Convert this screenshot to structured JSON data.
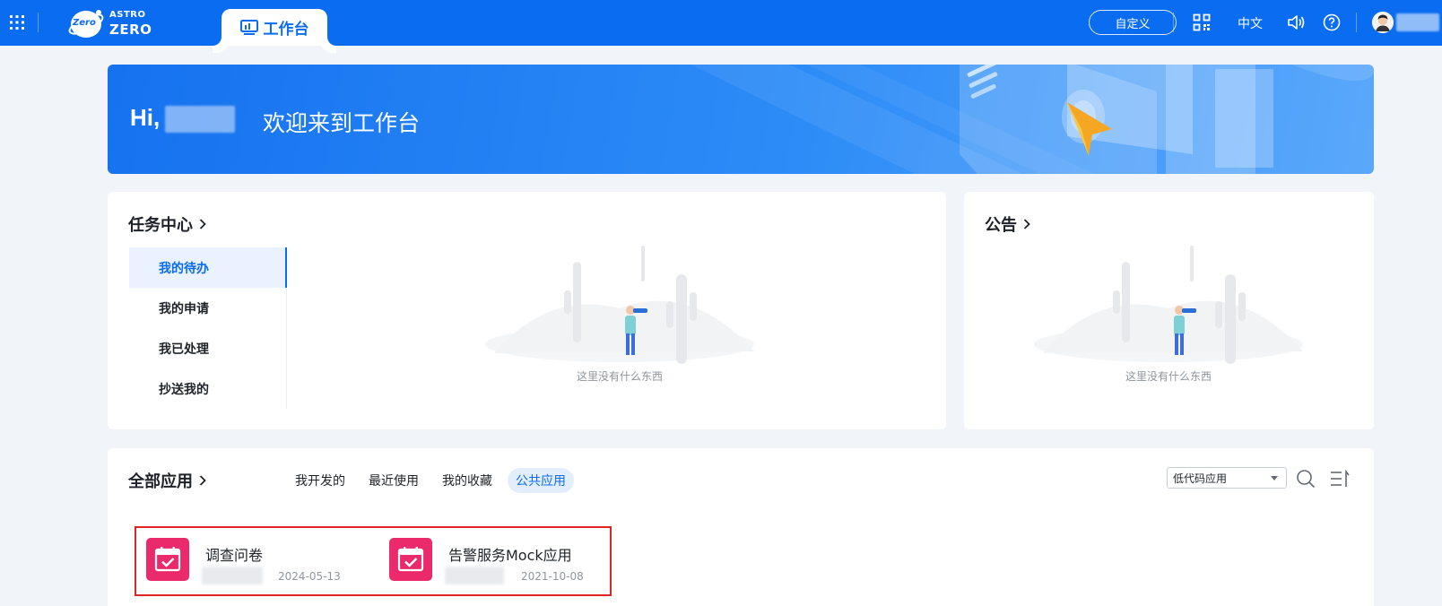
{
  "header": {
    "logo_small": "ASTRO",
    "logo_big": "ZERO",
    "logo_badge": "Zero",
    "active_tab": "工作台",
    "customize": "自定义",
    "language": "中文",
    "icons": [
      "app-grid-icon",
      "qr-code-icon",
      "speaker-icon",
      "help-icon"
    ]
  },
  "banner": {
    "hi": "Hi,",
    "welcome": "欢迎来到工作台"
  },
  "task_center": {
    "title": "任务中心",
    "items": [
      {
        "label": "我的待办",
        "active": true
      },
      {
        "label": "我的申请",
        "active": false
      },
      {
        "label": "我已处理",
        "active": false
      },
      {
        "label": "抄送我的",
        "active": false
      }
    ],
    "empty_text": "这里没有什么东西"
  },
  "announcement": {
    "title": "公告",
    "empty_text": "这里没有什么东西"
  },
  "apps": {
    "title": "全部应用",
    "tabs": [
      {
        "label": "我开发的",
        "active": false
      },
      {
        "label": "最近使用",
        "active": false
      },
      {
        "label": "我的收藏",
        "active": false
      },
      {
        "label": "公共应用",
        "active": true
      }
    ],
    "filter_value": "低代码应用",
    "items": [
      {
        "name": "调查问卷",
        "date": "2024-05-13"
      },
      {
        "name": "告警服务Mock应用",
        "date": "2021-10-08"
      }
    ]
  },
  "colors": {
    "primary": "#0a6cf0",
    "app_icon": "#ea2a6a",
    "highlight": "#e02424"
  }
}
